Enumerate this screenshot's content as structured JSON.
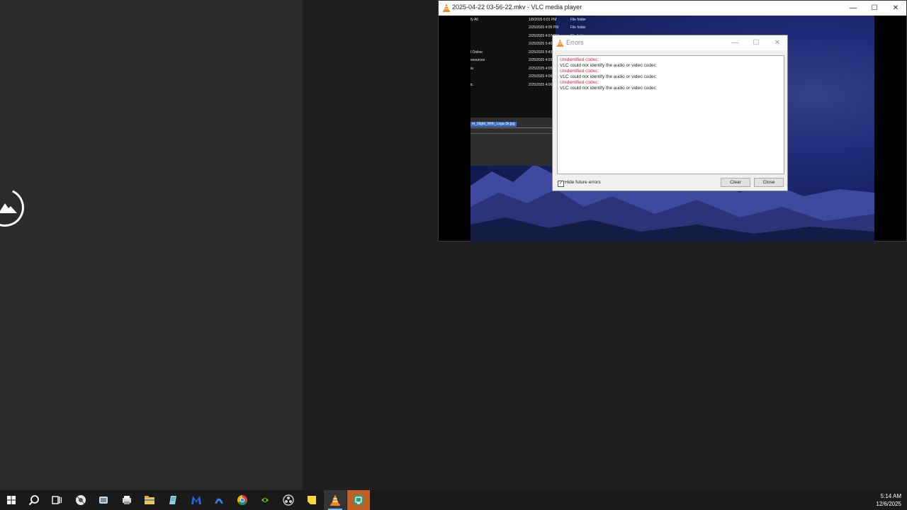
{
  "vlc": {
    "title": "2025-04-22 03-56-22.mkv - VLC media player",
    "explorer": {
      "rows": [
        {
          "name": "fy All",
          "date": "1/8/2025 6:01 PM",
          "type": "File folder"
        },
        {
          "name": "",
          "date": "2/25/2025 4:05 PM",
          "type": "File folder"
        },
        {
          "name": "",
          "date": "2/25/2025 4:07 PM",
          "type": "File folder"
        },
        {
          "name": "",
          "date": "2/25/2025 5:40",
          "type": ""
        },
        {
          "name": "l Online",
          "date": "2/25/2025 5:43",
          "type": ""
        },
        {
          "name": "esources",
          "date": "2/25/2025 4:03",
          "type": ""
        },
        {
          "name": "ia",
          "date": "2/25/2025 4:05",
          "type": ""
        },
        {
          "name": "",
          "date": "2/25/2025 4:06",
          "type": ""
        },
        {
          "name": "ic",
          "date": "2/25/2025 4:06",
          "type": ""
        }
      ],
      "selected_file": "re_Night_With_Lega-2k.jpg"
    }
  },
  "errors_dialog": {
    "title": "Errors",
    "lines": [
      {
        "kind": "err",
        "text": "Unidentified codec:"
      },
      {
        "kind": "msg",
        "text": "VLC could not identify the audio or video codec"
      },
      {
        "kind": "err",
        "text": "Unidentified codec:"
      },
      {
        "kind": "msg",
        "text": "VLC could not identify the audio or video codec"
      },
      {
        "kind": "err",
        "text": "Unidentified codec:"
      },
      {
        "kind": "msg",
        "text": "VLC could not identify the audio or video codec"
      }
    ],
    "hide_future_errors_label": "Hide future errors",
    "hide_future_errors_checked": true,
    "clear_label": "Clear",
    "close_label": "Close"
  },
  "taskbar": {
    "icons": [
      "windows-start-icon",
      "search-icon",
      "task-view-icon",
      "steam-icon",
      "app-icon",
      "printer-app-icon",
      "file-explorer-icon",
      "notepad-icon",
      "malwarebytes-icon",
      "vpn-icon",
      "chrome-icon",
      "nvidia-icon",
      "obs-icon",
      "sticky-notes-icon",
      "vlc-icon",
      "screen-capture-icon"
    ],
    "time": "5:14 AM",
    "date": "12/6/2025"
  },
  "colors": {
    "error_text": "#e0203a",
    "vlc_orange": "#f08a24",
    "taskbar_highlight": "#c15f24",
    "active_indicator": "#76b9ed"
  }
}
